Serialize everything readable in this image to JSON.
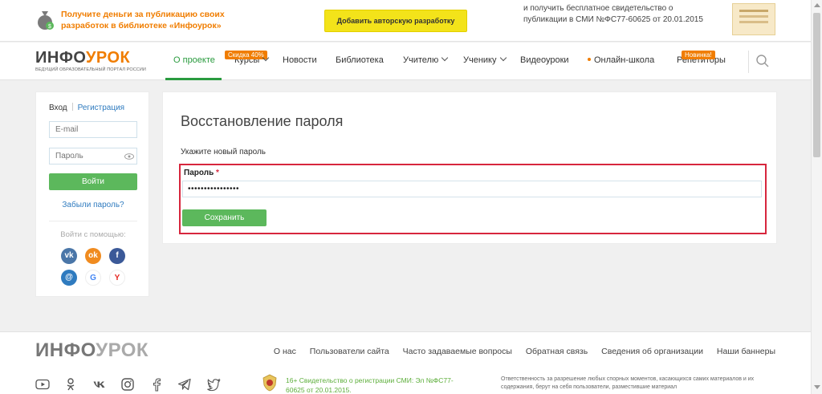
{
  "banner": {
    "promo_text": "Получите деньги за публикацию своих разработок в библиотеке «Инфоурок»",
    "button_label": "Добавить авторскую разработку",
    "right_text": "и получить бесплатное свидетельство о публикации в СМИ №ФС77-60625 от 20.01.2015"
  },
  "nav": {
    "logo_part1": "ИНФО",
    "logo_part2": "УРОК",
    "logo_sub": "ВЕДУЩИЙ ОБРАЗОВАТЕЛЬНЫЙ ПОРТАЛ РОССИИ",
    "items": [
      {
        "label": "О проекте"
      },
      {
        "label": "Курсы",
        "badge": "Скидка 40%"
      },
      {
        "label": "Новости"
      },
      {
        "label": "Библиотека"
      },
      {
        "label": "Учителю"
      },
      {
        "label": "Ученику"
      },
      {
        "label": "Видеоуроки"
      },
      {
        "label": "Онлайн-школа"
      },
      {
        "label": "Репетиторы",
        "badge": "Новинка!"
      }
    ]
  },
  "login": {
    "tab_login": "Вход",
    "tab_register": "Регистрация",
    "email_placeholder": "E-mail",
    "password_placeholder": "Пароль",
    "submit_label": "Войти",
    "forgot_label": "Забыли пароль?",
    "social_caption": "Войти с помощью:"
  },
  "main": {
    "title": "Восстановление пароля",
    "hint": "Укажите новый пароль",
    "password_label": "Пароль",
    "required_mark": "*",
    "password_value": "••••••••••••••••",
    "save_label": "Сохранить"
  },
  "footer": {
    "logo_part1": "ИНФО",
    "logo_part2": "УРОК",
    "links": [
      "О нас",
      "Пользователи сайта",
      "Часто задаваемые вопросы",
      "Обратная связь",
      "Сведения об организации",
      "Наши баннеры"
    ],
    "cert_text": "16+ Свидетельство о регистрации СМИ: Эл №ФС77-60625 от 20.01.2015.",
    "legal_text": "Ответственность за разрешение любых спорных моментов, касающихся самих материалов и их содержания, берут на себя пользователи, разместившие материал"
  },
  "colors": {
    "accent_green": "#5cb85c",
    "brand_orange": "#f07d00",
    "link_blue": "#2f7bbf",
    "highlight_red": "#d7263d"
  }
}
